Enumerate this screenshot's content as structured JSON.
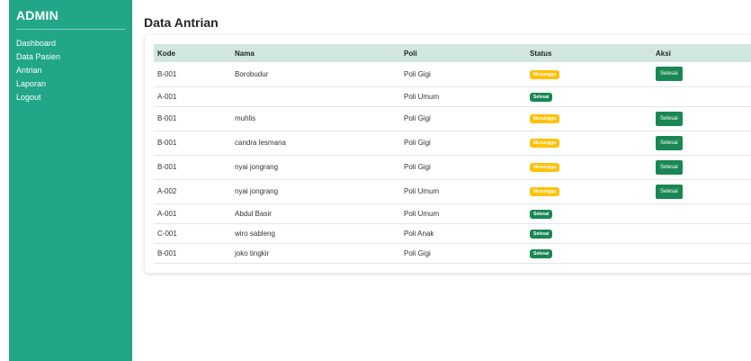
{
  "sidebar": {
    "brand": "ADMIN",
    "items": [
      {
        "label": "Dashboard"
      },
      {
        "label": "Data Pasien"
      },
      {
        "label": "Antrian"
      },
      {
        "label": "Laporan"
      },
      {
        "label": "Logout"
      }
    ],
    "color": "#21a688"
  },
  "main": {
    "title": "Data Antrian",
    "table": {
      "headers": [
        "Kode",
        "Nama",
        "Poli",
        "Status",
        "Aksi"
      ],
      "rows": [
        {
          "kode": "B-001",
          "nama": "Borobudur",
          "poli": "Poli Gigi",
          "status": "Menunggu",
          "aksi": "Selesai"
        },
        {
          "kode": "A-001",
          "nama": "",
          "poli": "Poli Umum",
          "status": "Selesai",
          "aksi": ""
        },
        {
          "kode": "B-001",
          "nama": "muhlis",
          "poli": "Poli Gigi",
          "status": "Menunggu",
          "aksi": "Selesai"
        },
        {
          "kode": "B-001",
          "nama": "candra lesmana",
          "poli": "Poli Gigi",
          "status": "Menunggu",
          "aksi": "Selesai"
        },
        {
          "kode": "B-001",
          "nama": "nyai jongrang",
          "poli": "Poli Gigi",
          "status": "Menunggu",
          "aksi": "Selesai"
        },
        {
          "kode": "A-002",
          "nama": "nyai jongrang",
          "poli": "Poli Umum",
          "status": "Menunggu",
          "aksi": "Selesai"
        },
        {
          "kode": "A-001",
          "nama": "Abdul Basir",
          "poli": "Poli Umum",
          "status": "Selesai",
          "aksi": ""
        },
        {
          "kode": "C-001",
          "nama": "wiro sableng",
          "poli": "Poli Anak",
          "status": "Selesai",
          "aksi": ""
        },
        {
          "kode": "B-001",
          "nama": "joko tingkir",
          "poli": "Poli Gigi",
          "status": "Selesai",
          "aksi": ""
        }
      ]
    },
    "colors": {
      "header_bg": "#d1e7dd",
      "waiting": "#ffc107",
      "done": "#198754"
    }
  }
}
